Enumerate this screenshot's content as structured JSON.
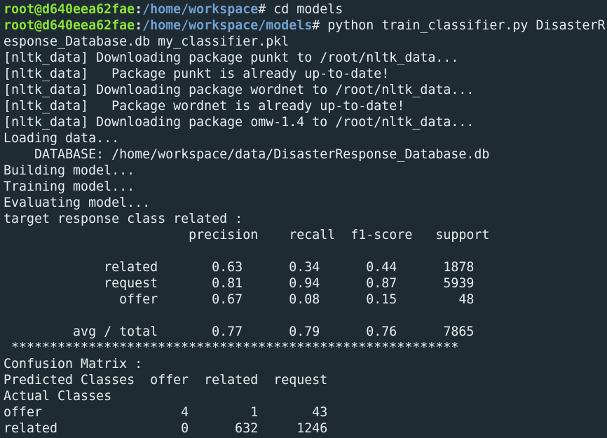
{
  "colors": {
    "background": "#1e2b33",
    "text": "#e8ecee",
    "prompt_user": "#8ae234",
    "prompt_path": "#729fcf"
  },
  "prompt1": {
    "user_host": "root@d640eea62fae",
    "colon": ":",
    "path": "/home/workspace",
    "sign": "# ",
    "command": "cd models"
  },
  "prompt2": {
    "user_host": "root@d640eea62fae",
    "colon": ":",
    "path": "/home/workspace/models",
    "sign": "# ",
    "command": "python train_classifier.py DisasterR"
  },
  "output_lines": [
    "esponse_Database.db my_classifier.pkl",
    "[nltk_data] Downloading package punkt to /root/nltk_data...",
    "[nltk_data]   Package punkt is already up-to-date!",
    "[nltk_data] Downloading package wordnet to /root/nltk_data...",
    "[nltk_data]   Package wordnet is already up-to-date!",
    "[nltk_data] Downloading package omw-1.4 to /root/nltk_data...",
    "Loading data...",
    "    DATABASE: /home/workspace/data/DisasterResponse_Database.db",
    "Building model...",
    "Training model...",
    "Evaluating model...",
    "target response class related :",
    "                        precision    recall  f1-score   support",
    "",
    "             related       0.63      0.34      0.44      1878",
    "             request       0.81      0.94      0.87      5939",
    "               offer       0.67      0.08      0.15        48",
    "",
    "         avg / total       0.77      0.79      0.76      7865",
    " **********************************************************",
    "Confusion Matrix :",
    "Predicted Classes  offer  related  request",
    "Actual Classes",
    "offer                  4        1       43",
    "related                0      632     1246"
  ]
}
